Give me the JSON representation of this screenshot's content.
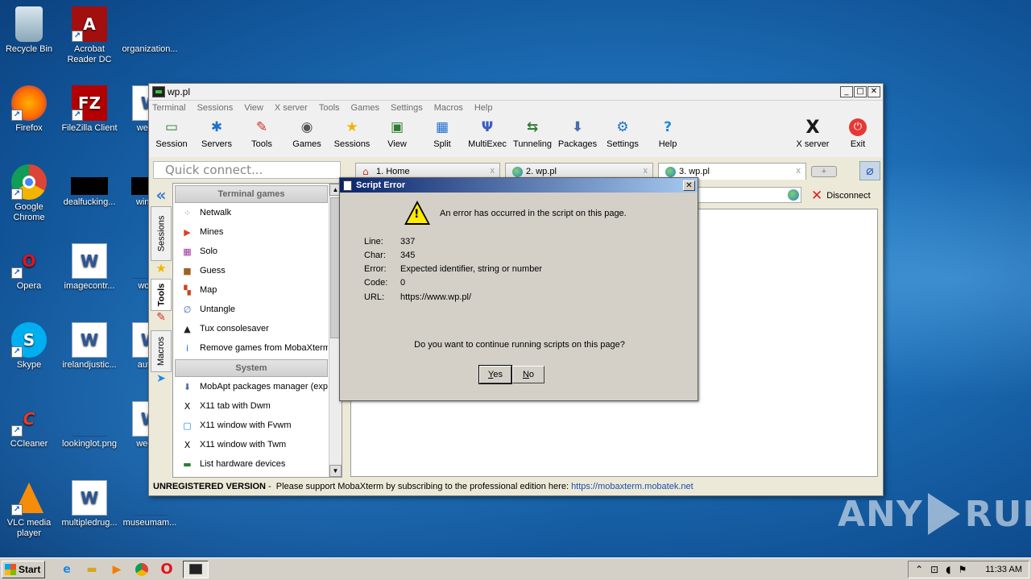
{
  "desktop": {
    "icons": [
      {
        "label": "Recycle Bin",
        "glyph": "",
        "icon": "recycle-bin-icon"
      },
      {
        "label": "Acrobat Reader DC",
        "glyph": "A",
        "icon": "acrobat-icon"
      },
      {
        "label": "organization...",
        "glyph": "",
        "icon": "file-icon"
      },
      {
        "label": "Firefox",
        "glyph": "",
        "icon": "firefox-icon"
      },
      {
        "label": "FileZilla Client",
        "glyph": "FZ",
        "icon": "filezilla-icon"
      },
      {
        "label": "weann",
        "glyph": "W",
        "icon": "word-doc-icon"
      },
      {
        "label": "Google Chrome",
        "glyph": "",
        "icon": "chrome-icon"
      },
      {
        "label": "dealfucking...",
        "glyph": "",
        "icon": "file-icon"
      },
      {
        "label": "winexe",
        "glyph": "",
        "icon": "file-icon"
      },
      {
        "label": "Opera",
        "glyph": "O",
        "icon": "opera-icon"
      },
      {
        "label": "imagecontr...",
        "glyph": "W",
        "icon": "word-doc-icon"
      },
      {
        "label": "woma",
        "glyph": "",
        "icon": "file-icon"
      },
      {
        "label": "Skype",
        "glyph": "S",
        "icon": "skype-icon"
      },
      {
        "label": "irelandjustic...",
        "glyph": "W",
        "icon": "word-doc-icon"
      },
      {
        "label": "autom",
        "glyph": "W",
        "icon": "word-doc-icon"
      },
      {
        "label": "CCleaner",
        "glyph": "C",
        "icon": "ccleaner-icon"
      },
      {
        "label": "lookinglot.png",
        "glyph": "",
        "icon": "image-file-icon"
      },
      {
        "label": "weekly",
        "glyph": "W",
        "icon": "word-doc-icon"
      },
      {
        "label": "VLC media player",
        "glyph": "",
        "icon": "vlc-icon"
      },
      {
        "label": "multipledrug...",
        "glyph": "W",
        "icon": "word-doc-icon"
      },
      {
        "label": "museumam...",
        "glyph": "",
        "icon": "file-icon"
      }
    ]
  },
  "window": {
    "title": "wp.pl",
    "controls": {
      "minimize": "_",
      "maximize": "□",
      "close": "✕"
    },
    "menu": [
      "Terminal",
      "Sessions",
      "View",
      "X server",
      "Tools",
      "Games",
      "Settings",
      "Macros",
      "Help"
    ],
    "toolbar": {
      "items": [
        {
          "label": "Session",
          "glyph": "▭",
          "color": "#2e7d32"
        },
        {
          "label": "Servers",
          "glyph": "✱",
          "color": "#1e6fd0"
        },
        {
          "label": "Tools",
          "glyph": "✎",
          "color": "#d32f2f"
        },
        {
          "label": "Games",
          "glyph": "◉",
          "color": "#555555"
        },
        {
          "label": "Sessions",
          "glyph": "★",
          "color": "#f4b400"
        },
        {
          "label": "View",
          "glyph": "▣",
          "color": "#2e7d32"
        },
        {
          "label": "Split",
          "glyph": "▦",
          "color": "#1e6fd0"
        },
        {
          "label": "MultiExec",
          "glyph": "Ψ",
          "color": "#3b5bc4"
        },
        {
          "label": "Tunneling",
          "glyph": "⇆",
          "color": "#2e7d32"
        },
        {
          "label": "Packages",
          "glyph": "⬇",
          "color": "#4b6da8"
        },
        {
          "label": "Settings",
          "glyph": "⚙",
          "color": "#1e6fd0"
        },
        {
          "label": "Help",
          "glyph": "?",
          "color": "#1e88e5"
        }
      ],
      "xserver_label": "X server",
      "exit_label": "Exit"
    },
    "quick_connect_placeholder": "Quick connect...",
    "tabs": [
      {
        "label": "1. Home"
      },
      {
        "label": "2. wp.pl"
      },
      {
        "label": "3. wp.pl"
      }
    ],
    "tab_close": "x",
    "tab_add": "+",
    "vertical_tabs": [
      "Sessions",
      "Tools",
      "Macros"
    ],
    "sidebar": {
      "section_games": "Terminal games",
      "games": [
        {
          "label": "Netwalk",
          "glyph": "⁘",
          "color": "#5a7fb5"
        },
        {
          "label": "Mines",
          "glyph": "▶",
          "color": "#e04020"
        },
        {
          "label": "Solo",
          "glyph": "▦",
          "color": "#a030a0"
        },
        {
          "label": "Guess",
          "glyph": "■",
          "color": "#a06020"
        },
        {
          "label": "Map",
          "glyph": "▚",
          "color": "#d04020"
        },
        {
          "label": "Untangle",
          "glyph": "∅",
          "color": "#3060b0"
        },
        {
          "label": "Tux consolesaver",
          "glyph": "▲",
          "color": "#202020"
        },
        {
          "label": "Remove games from MobaXterm",
          "glyph": "i",
          "color": "#1e6fd0"
        }
      ],
      "section_system": "System",
      "system": [
        {
          "label": "MobApt packages manager (expe",
          "glyph": "⬇",
          "color": "#4b6da8"
        },
        {
          "label": "X11 tab with Dwm",
          "glyph": "X",
          "color": "#000000"
        },
        {
          "label": "X11 window with Fvwm",
          "glyph": "▢",
          "color": "#1e88e5"
        },
        {
          "label": "X11 window with Twm",
          "glyph": "X",
          "color": "#000000"
        },
        {
          "label": "List hardware devices",
          "glyph": "▬",
          "color": "#2e7d32"
        }
      ]
    },
    "disconnect_label": "Disconnect",
    "status": {
      "unregistered": "UNREGISTERED VERSION",
      "message": " -  Please support MobaXterm by subscribing to the professional edition here: ",
      "link": "https://mobaxterm.mobatek.net"
    }
  },
  "dialog": {
    "title": "Script Error",
    "message": "An error has occurred in the script on this page.",
    "fields": [
      {
        "key": "Line:",
        "value": "337"
      },
      {
        "key": "Char:",
        "value": "345"
      },
      {
        "key": "Error:",
        "value": "Expected identifier, string or number"
      },
      {
        "key": "Code:",
        "value": "0"
      },
      {
        "key": "URL:",
        "value": "https://www.wp.pl/"
      }
    ],
    "question": "Do you want to continue running scripts on this page?",
    "yes": "Yes",
    "no": "No"
  },
  "taskbar": {
    "start": "Start",
    "clock": "11:33 AM"
  },
  "watermark": {
    "left": "ANY",
    "right": "RUN"
  }
}
